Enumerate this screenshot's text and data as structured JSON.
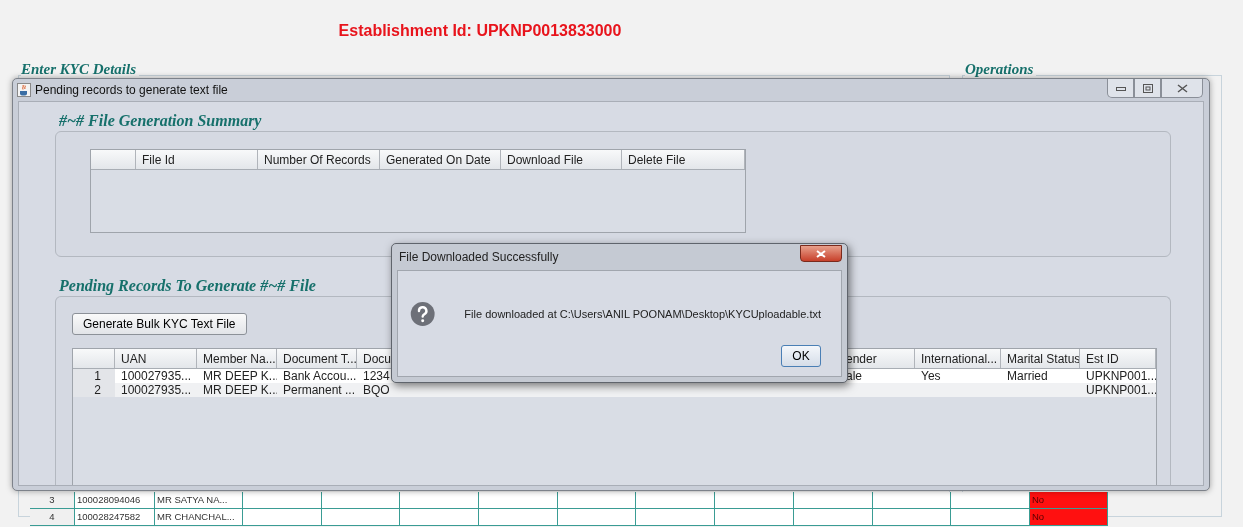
{
  "page": {
    "title": "Establishment Id: UPKNP0013833000",
    "left_section": "Enter KYC Details",
    "right_section": "Operations"
  },
  "background_grid": {
    "rows": [
      {
        "number": "3",
        "uan": "100028094046",
        "name": "MR SATYA NA...",
        "flag": "No"
      },
      {
        "number": "4",
        "uan": "100028247582",
        "name": "MR CHANCHAL...",
        "flag": "No"
      }
    ]
  },
  "window": {
    "title": "Pending records to generate text file",
    "summary": {
      "heading": "#~# File Generation Summary",
      "columns": [
        "File Id",
        "Number Of Records",
        "Generated On Date",
        "Download File",
        "Delete File"
      ]
    },
    "pending": {
      "heading": "Pending Records To Generate #~# File",
      "button": "Generate Bulk KYC Text File",
      "columns": [
        "",
        "UAN",
        "Member Na...",
        "Document T...",
        "Docu",
        "ender",
        "International...",
        "Marital Status",
        "Est ID"
      ],
      "rows": [
        [
          "1",
          "100027935...",
          "MR DEEP K...",
          "Bank Accou...",
          "1234",
          "ale",
          "Yes",
          "Married",
          "UPKNP001..."
        ],
        [
          "2",
          "100027935...",
          "MR DEEP K...",
          "Permanent ...",
          "BQO",
          "",
          "",
          "",
          "UPKNP001..."
        ]
      ]
    }
  },
  "dialog": {
    "title": "File Downloaded Successfully",
    "message": "File downloaded at C:\\Users\\ANIL POONAM\\Desktop\\KYCUploadable.txt",
    "button": "OK"
  }
}
